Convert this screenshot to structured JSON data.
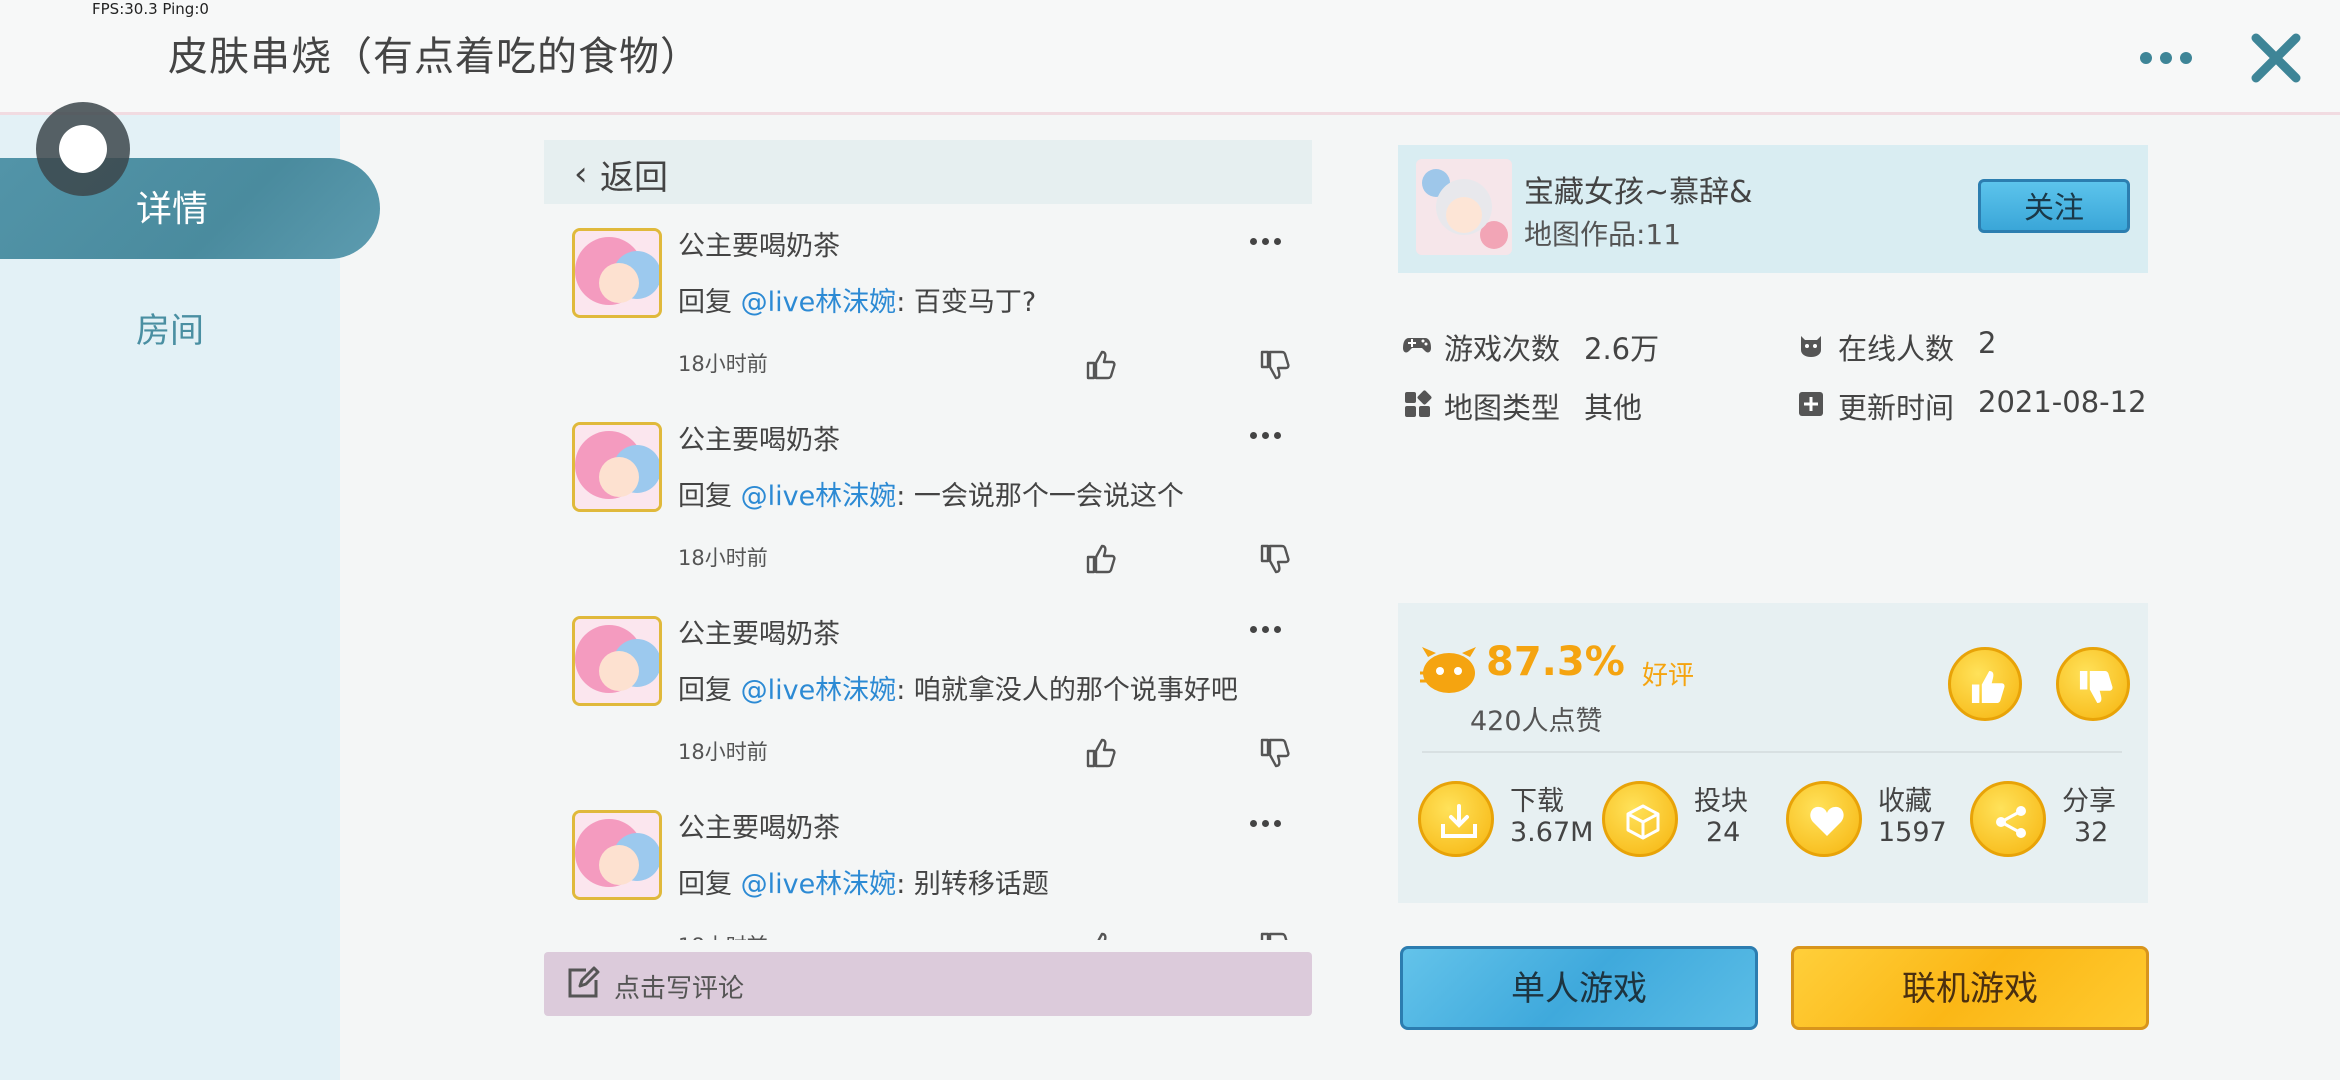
{
  "overlay": {
    "fps_text": "FPS:30.3  Ping:0"
  },
  "header": {
    "title": "皮肤串烧（有点着吃的食物）"
  },
  "sidebar": {
    "items": [
      {
        "label": "详情"
      },
      {
        "label": "房间"
      }
    ]
  },
  "comments_panel": {
    "back_label": "返回",
    "items": [
      {
        "user": "公主要喝奶茶",
        "prefix": "回复 ",
        "mention": "@live林沫婉",
        "text": ": 百变马丁?",
        "time": "18小时前"
      },
      {
        "user": "公主要喝奶茶",
        "prefix": "回复 ",
        "mention": "@live林沫婉",
        "text": ": 一会说那个一会说这个",
        "time": "18小时前"
      },
      {
        "user": "公主要喝奶茶",
        "prefix": "回复 ",
        "mention": "@live林沫婉",
        "text": ": 咱就拿没人的那个说事好吧",
        "time": "18小时前"
      },
      {
        "user": "公主要喝奶茶",
        "prefix": "回复 ",
        "mention": "@live林沫婉",
        "text": ": 别转移话题",
        "time": "18小时前"
      }
    ],
    "write_placeholder": "点击写评论"
  },
  "author": {
    "name": "宝藏女孩~慕辞&",
    "works": "地图作品:11",
    "follow_label": "关注"
  },
  "stats": {
    "plays": {
      "label": "游戏次数",
      "value": "2.6万"
    },
    "online": {
      "label": "在线人数",
      "value": "2"
    },
    "map_type": {
      "label": "地图类型",
      "value": "其他"
    },
    "updated": {
      "label": "更新时间",
      "value": "2021-08-12"
    }
  },
  "rating": {
    "percent": "87.3%",
    "good_label": "好评",
    "likes": "420人点赞",
    "actions": [
      {
        "label": "下载",
        "value": "3.67M"
      },
      {
        "label": "投块",
        "value": "24"
      },
      {
        "label": "收藏",
        "value": "1597"
      },
      {
        "label": "分享",
        "value": "32"
      }
    ]
  },
  "buttons": {
    "single": "单人游戏",
    "multi": "联机游戏"
  },
  "colors": {
    "accent_teal": "#4a8b9e",
    "blue_button": "#3fa9dc",
    "orange_button": "#fbb716",
    "rating_orange": "#f5a410",
    "mention_blue": "#2c8ad4"
  }
}
